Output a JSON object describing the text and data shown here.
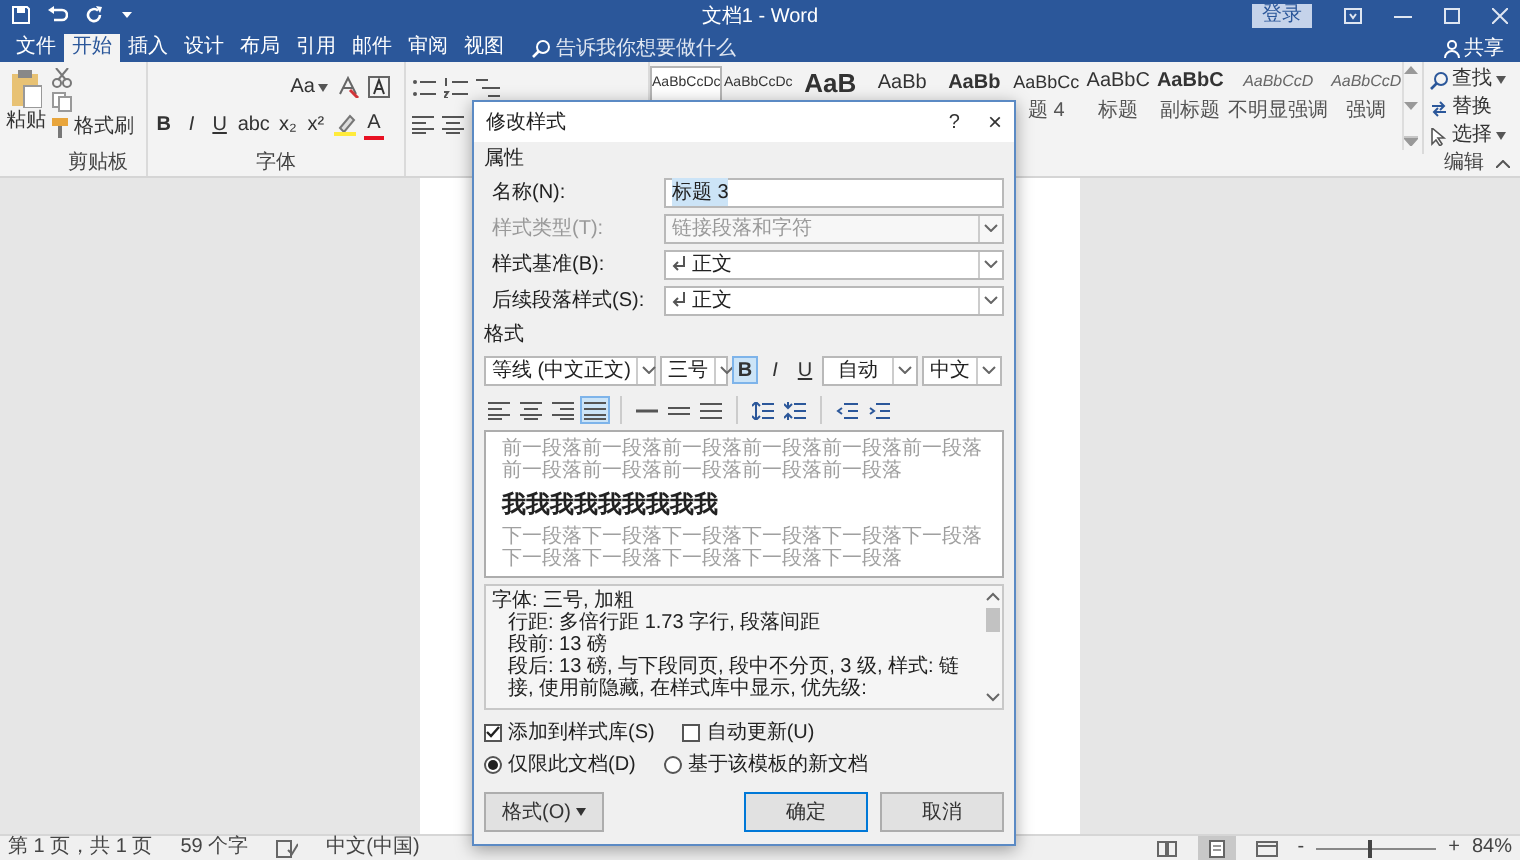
{
  "window": {
    "title": "文档1 - Word",
    "sign_in": "登录"
  },
  "tabs": [
    {
      "label": "文件",
      "selected": false
    },
    {
      "label": "开始",
      "selected": true
    },
    {
      "label": "插入",
      "selected": false
    },
    {
      "label": "设计",
      "selected": false
    },
    {
      "label": "布局",
      "selected": false
    },
    {
      "label": "引用",
      "selected": false
    },
    {
      "label": "邮件",
      "selected": false
    },
    {
      "label": "审阅",
      "selected": false
    },
    {
      "label": "视图",
      "selected": false
    }
  ],
  "tell_me": {
    "placeholder": "告诉我你想要做什么"
  },
  "share": "共享",
  "ribbon": {
    "clipboard": {
      "paste": "粘贴",
      "format_painter": "格式刷",
      "label": "剪贴板"
    },
    "font": {
      "change_case": "Aa",
      "buttons": [
        "B",
        "I",
        "U",
        "abc",
        "x₂",
        "x²"
      ],
      "font_color": "A",
      "label": "字体"
    },
    "styles": [
      {
        "preview": "AaBbCcDc",
        "kind": "small",
        "selected": true
      },
      {
        "preview": "AaBbCcDc",
        "kind": "small",
        "selected": false
      },
      {
        "preview": "AaB",
        "kind": "large",
        "selected": false
      },
      {
        "preview": "AaBb",
        "kind": "medium",
        "selected": false
      },
      {
        "preview": "AaBb",
        "kind": "medium-bold",
        "selected": false
      },
      {
        "preview": "AaBbCc",
        "label": "题 4",
        "kind": "normal",
        "selected": false
      },
      {
        "preview": "AaBbC",
        "label": "标题",
        "kind": "medium",
        "selected": false
      },
      {
        "preview": "AaBbC",
        "label": "副标题",
        "kind": "medium-bold",
        "selected": false
      },
      {
        "preview": "AaBbCcD",
        "label": "不明显强调",
        "kind": "emphasis",
        "selected": false
      },
      {
        "preview": "AaBbCcD",
        "label": "强调",
        "kind": "emphasis",
        "selected": false
      }
    ],
    "editing": {
      "find": "查找",
      "replace": "替换",
      "select": "选择",
      "label": "编辑"
    }
  },
  "dialog": {
    "title": "修改样式",
    "help": "?",
    "close": "×",
    "properties_heading": "属性",
    "fields": [
      {
        "label": "名称(N):",
        "value": "标题 3",
        "kind": "text",
        "disabled": false
      },
      {
        "label": "样式类型(T):",
        "value": "链接段落和字符",
        "kind": "dropdown",
        "disabled": true
      },
      {
        "label": "样式基准(B):",
        "value": "正文",
        "kind": "style-dropdown",
        "disabled": false
      },
      {
        "label": "后续段落样式(S):",
        "value": "正文",
        "kind": "style-dropdown",
        "disabled": false
      }
    ],
    "format_heading": "格式",
    "font": "等线 (中文正文)",
    "size": "三号",
    "style_buttons": [
      {
        "label": "B",
        "selected": true
      },
      {
        "label": "I",
        "selected": false
      },
      {
        "label": "U",
        "selected": false
      }
    ],
    "font_color_setting": "自动",
    "script": "中文",
    "alignment": [
      {
        "kind": "left",
        "selected": false
      },
      {
        "kind": "center",
        "selected": false
      },
      {
        "kind": "right",
        "selected": false
      },
      {
        "kind": "justify",
        "selected": true
      }
    ],
    "preview": {
      "before": "前一段落前一段落前一段落前一段落前一段落前一段落前一段落前一段落前一段落前一段落前一段落",
      "sample": "我我我我我我我我我",
      "after": "下一段落下一段落下一段落下一段落下一段落下一段落下一段落下一段落下一段落下一段落下一段落"
    },
    "description": [
      "字体: 三号, 加粗",
      "行距: 多倍行距 1.73 字行, 段落间距",
      "段前: 13 磅",
      "段后: 13 磅, 与下段同页, 段中不分页, 3 级, 样式: 链接, 使用前隐藏, 在样式库中显示, 优先级:"
    ],
    "checkboxes": [
      {
        "label": "添加到样式库(S)",
        "checked": true
      },
      {
        "label": "自动更新(U)",
        "checked": false
      }
    ],
    "radios": [
      {
        "label": "仅限此文档(D)",
        "selected": true
      },
      {
        "label": "基于该模板的新文档",
        "selected": false
      }
    ],
    "format_button": "格式(O)",
    "ok": "确定",
    "cancel": "取消"
  },
  "status_bar": {
    "page": "第 1 页，共 1 页",
    "words": "59 个字",
    "language": "中文(中国)",
    "views": [
      {
        "kind": "read",
        "selected": false
      },
      {
        "kind": "print",
        "selected": true
      },
      {
        "kind": "web",
        "selected": false
      }
    ],
    "zoom_out": "-",
    "zoom_in": "+",
    "zoom": {
      "level": 0.45
    },
    "zoom_percent": "84%"
  }
}
